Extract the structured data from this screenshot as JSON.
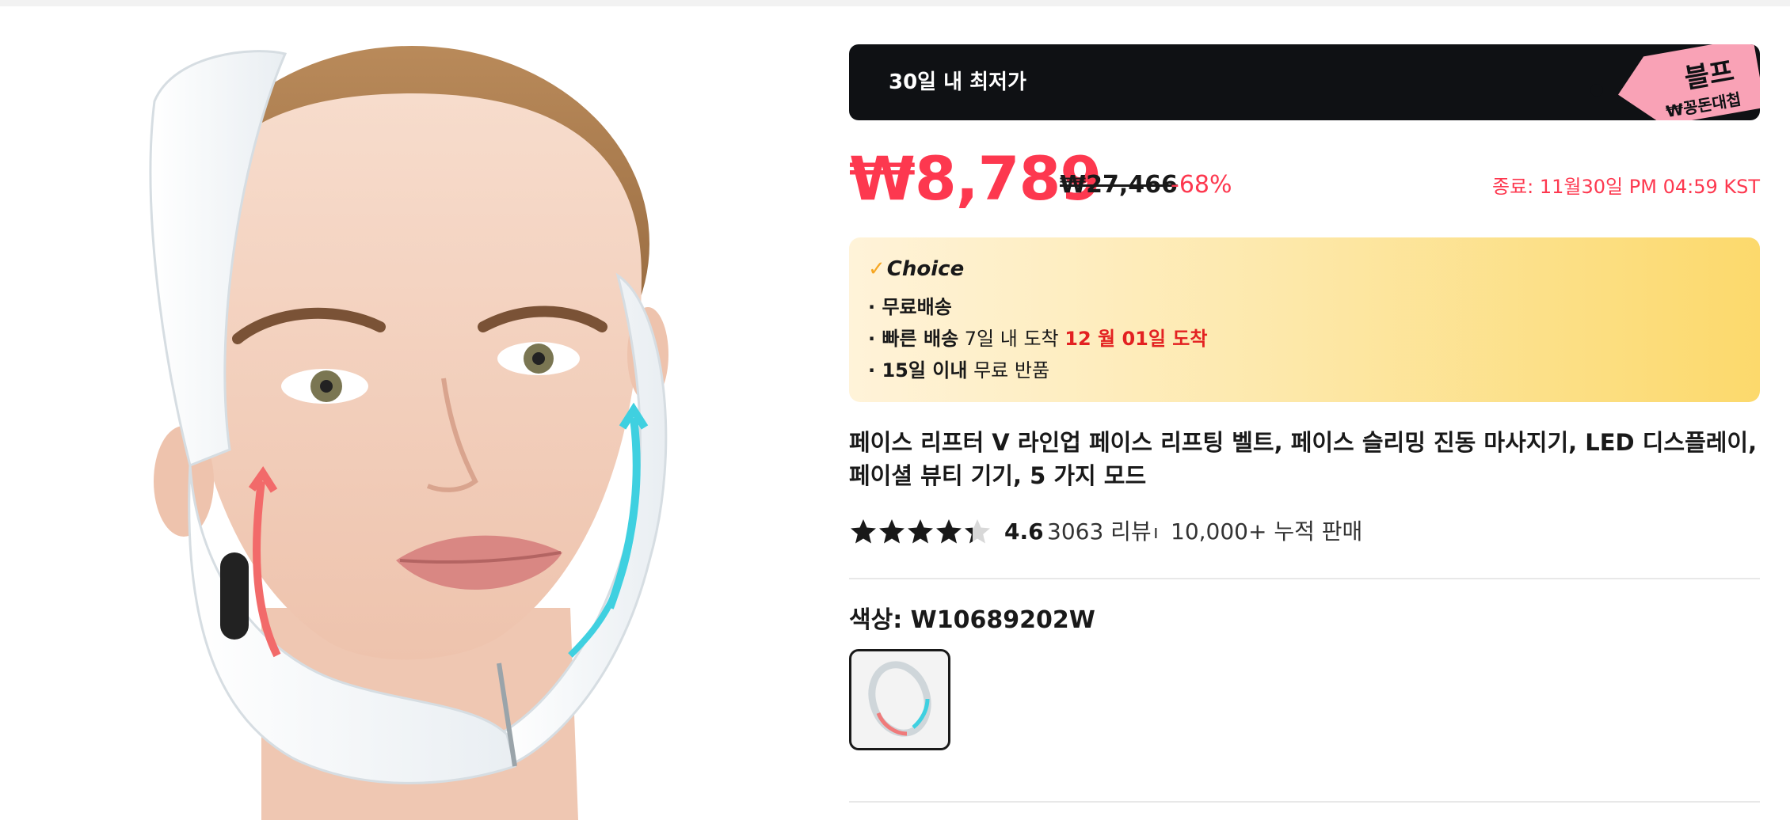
{
  "banner": {
    "text": "30일 내 최저가",
    "tag_line1": "블프",
    "tag_line2": "₩꽁돈대첩"
  },
  "price": {
    "current": "₩8,789",
    "original": "₩27,466",
    "discount": "-68%",
    "ends": "종료: 11월30일 PM 04:59 KST"
  },
  "choice": {
    "label": "Choice",
    "lines": [
      {
        "bold": "· 무료배송",
        "normal": "",
        "highlight": ""
      },
      {
        "bold": "· 빠른 배송",
        "normal": " 7일 내 도착 ",
        "highlight": "12 월 01일 도착"
      },
      {
        "bold": "· 15일 이내",
        "normal": "  무료 반품",
        "highlight": ""
      }
    ]
  },
  "product": {
    "title": "페이스 리프터 V 라인업 페이스 리프팅 벨트, 페이스 슬리밍 진동 마사지기, LED 디스플레이, 페이셜 뷰티 기기, 5 가지 모드",
    "rating": "4.6",
    "rating_value": 4.6,
    "reviews": "3063 리뷰",
    "separator": "ı",
    "sold": "10,000+ 누적 판매"
  },
  "variant": {
    "label": "색상: W10689202W"
  },
  "colors": {
    "accent": "#fd384f",
    "banner_bg": "#0f1114",
    "tag_bg": "#f9a2b6",
    "teal": "#3fd0e0"
  }
}
